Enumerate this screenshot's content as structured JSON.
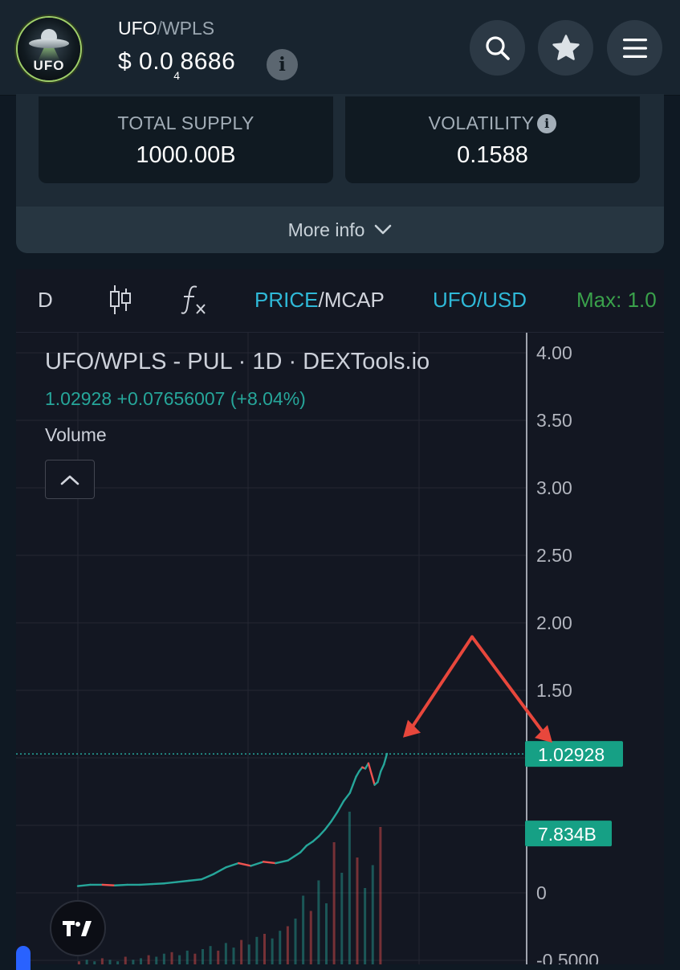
{
  "header": {
    "logo_text": "UFO",
    "pair_base": "UFO",
    "pair_sep": "/",
    "pair_quote": "WPLS",
    "price_prefix": "$ 0.0",
    "price_sub": "4",
    "price_suffix": "8686",
    "info_glyph": "i",
    "icons": [
      "search-icon",
      "star-icon",
      "menu-icon"
    ]
  },
  "stats": {
    "total_supply_label": "TOTAL SUPPLY",
    "total_supply_value": "1000.00B",
    "volatility_label": "VOLATILITY",
    "volatility_value": "0.1588",
    "more_info": "More info"
  },
  "toolbar": {
    "interval": "D",
    "price_label": "PRICE",
    "slash": "/",
    "mcap_label": "MCAP",
    "pair_usd": "UFO/USD",
    "max_label": "Max: 1.0"
  },
  "chart_legend": {
    "title": "UFO/WPLS - PUL · 1D · DEXTools.io",
    "values": "1.02928 +0.07656007 (+8.04%)",
    "volume": "Volume"
  },
  "chart_data": {
    "type": "line",
    "title": "UFO/WPLS - PUL · 1D · DEXTools.io",
    "y_ticks": [
      "4.00",
      "3.50",
      "3.00",
      "2.50",
      "2.00",
      "1.50",
      "0",
      "-0.5000"
    ],
    "ylim": [
      -0.5,
      4.0
    ],
    "last_price_label": "1.02928",
    "last_price": 1.02928,
    "volume_label": "7.834B",
    "grid": true,
    "x": [
      0,
      4,
      8,
      12,
      16,
      20,
      24,
      28,
      32,
      36,
      40,
      44,
      48,
      52,
      56,
      60,
      64,
      68,
      70,
      72,
      74,
      76,
      78,
      80,
      82,
      84,
      86,
      88,
      89,
      90,
      91,
      92,
      93,
      94,
      95,
      96,
      97,
      98,
      99,
      100
    ],
    "values": [
      0.05,
      0.06,
      0.06,
      0.055,
      0.06,
      0.06,
      0.065,
      0.07,
      0.08,
      0.09,
      0.1,
      0.14,
      0.19,
      0.22,
      0.2,
      0.23,
      0.22,
      0.24,
      0.27,
      0.3,
      0.35,
      0.38,
      0.42,
      0.47,
      0.53,
      0.6,
      0.68,
      0.74,
      0.8,
      0.86,
      0.9,
      0.93,
      0.92,
      0.96,
      0.88,
      0.8,
      0.82,
      0.9,
      0.95,
      1.03
    ],
    "volume_bars": [
      0.02,
      0.03,
      0.02,
      0.04,
      0.03,
      0.02,
      0.05,
      0.03,
      0.04,
      0.06,
      0.05,
      0.07,
      0.08,
      0.06,
      0.09,
      0.07,
      0.1,
      0.12,
      0.09,
      0.14,
      0.11,
      0.16,
      0.13,
      0.18,
      0.2,
      0.17,
      0.22,
      0.25,
      0.3,
      0.45,
      0.35,
      0.55,
      0.4,
      0.8,
      0.6,
      1.0,
      0.7,
      0.5,
      0.65,
      0.9
    ],
    "colors": {
      "up": "#26a69a",
      "down": "#ef5350",
      "arrow": "#e8473c",
      "grid": "#242733"
    }
  }
}
